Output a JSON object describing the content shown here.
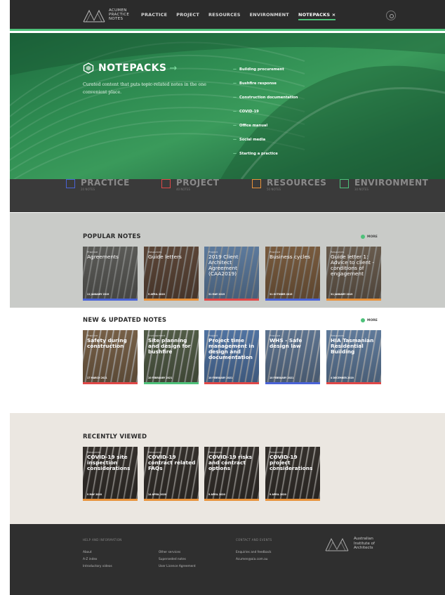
{
  "header": {
    "logo_lines": [
      "ACUMEN",
      "PRACTICE",
      "NOTES"
    ],
    "nav": [
      "PRACTICE",
      "PROJECT",
      "RESOURCES",
      "ENVIRONMENT",
      "NOTEPACKS ×"
    ]
  },
  "notepacks_menu": {
    "title": "NOTEPACKS",
    "title_arrow": "→",
    "description": "Curated content that puts topic-related notes in the one convenient place.",
    "links": [
      "Building procurement",
      "Bushfire response",
      "Construction documentation",
      "COVID-19",
      "Office manual",
      "Social media",
      "Starting a practice"
    ]
  },
  "categories": [
    {
      "label": "PRACTICE",
      "sub": "20 NOTES",
      "color": "#4a63d6"
    },
    {
      "label": "PROJECT",
      "sub": "40 NOTES",
      "color": "#e04848"
    },
    {
      "label": "RESOURCES",
      "sub": "50 NOTES",
      "color": "#e8923a"
    },
    {
      "label": "ENVIRONMENT",
      "sub": "30 NOTES",
      "color": "#4ec17a"
    }
  ],
  "popular": {
    "title": "POPULAR NOTES",
    "more": "MORE",
    "cards": [
      {
        "cat": "Practice",
        "title": "Agreements",
        "date": "11 JANUARY 2019",
        "bar": "#4a63d6",
        "bg": "#6a6a66"
      },
      {
        "cat": "Resources",
        "title": "Guide letters",
        "date": "9 APRIL 2020",
        "bar": "#e8923a",
        "bg": "#6b5140"
      },
      {
        "cat": "Project",
        "title": "2019 Client Architect Agreement (CAA2019)",
        "date": "31 MAY 2019",
        "bar": "#e04848",
        "bg": "#6c8fb8"
      },
      {
        "cat": "Practice",
        "title": "Business cycles",
        "date": "31 OCTOBER 2015",
        "bar": "#4a63d6",
        "bg": "#8d6a48"
      },
      {
        "cat": "Resources",
        "title": "Guide letter 1: Advice to client - conditions of engagement",
        "date": "31 JANUARY 2019",
        "bar": "#e8923a",
        "bg": "#7a6a5a"
      }
    ]
  },
  "new_updated": {
    "title": "NEW & UPDATED NOTES",
    "more": "MORE",
    "cards": [
      {
        "cat": "Practice",
        "title": "Safety during construction",
        "date": "17 MARCH 2021",
        "bar": "#e04848",
        "bg": "#8a6f52"
      },
      {
        "cat": "Environment",
        "title": "Site planning and design for bushfire",
        "date": "10 FEBRUARY 2021",
        "bar": "#4ec17a",
        "bg": "#5f6b52"
      },
      {
        "cat": "Project",
        "title": "Project time management in design and documentation",
        "date": "10 FEBRUARY 2021",
        "bar": "#e04848",
        "bg": "#5d86bd"
      },
      {
        "cat": "Practice",
        "title": "WHS - Safe design law",
        "date": "10 FEBRUARY 2021",
        "bar": "#4a63d6",
        "bg": "#6d87a8"
      },
      {
        "cat": "Resources",
        "title": "HIA Tasmanian Residential Building",
        "date": "4 DECEMBER 2020",
        "bar": "#e04848",
        "bg": "#6f8fb5"
      }
    ]
  },
  "recent": {
    "title": "RECENTLY VIEWED",
    "cards": [
      {
        "cat": "Resources",
        "title": "COVID-19 site inspection considerations",
        "date": "9 MAY 2020",
        "bar": "#e8923a",
        "bg": "#3d3833"
      },
      {
        "cat": "Resources",
        "title": "COVID-19 contract related FAQs",
        "date": "14 APRIL 2020",
        "bar": "#e8923a",
        "bg": "#3d3833"
      },
      {
        "cat": "Resources",
        "title": "COVID-19 risks and contract options",
        "date": "9 APRIL 2020",
        "bar": "#e8923a",
        "bg": "#3d3833"
      },
      {
        "cat": "Resources",
        "title": "COVID-19 project considerations",
        "date": "9 APRIL 2020",
        "bar": "#e8923a",
        "bg": "#3d3833"
      }
    ]
  },
  "footer": {
    "col1_head": "HELP AND INFORMATION",
    "col1": [
      "About",
      "A-Z index",
      "Introductory videos"
    ],
    "col2": [
      "Other services",
      "Superseded notes",
      "User Licence Agreement"
    ],
    "col3_head": "CONTACT AND EVENTS",
    "col3": [
      "Enquiries and feedback",
      "Acumen@aia.com.au"
    ],
    "aia_lines": [
      "Australian",
      "Institute of",
      "Architects"
    ]
  }
}
